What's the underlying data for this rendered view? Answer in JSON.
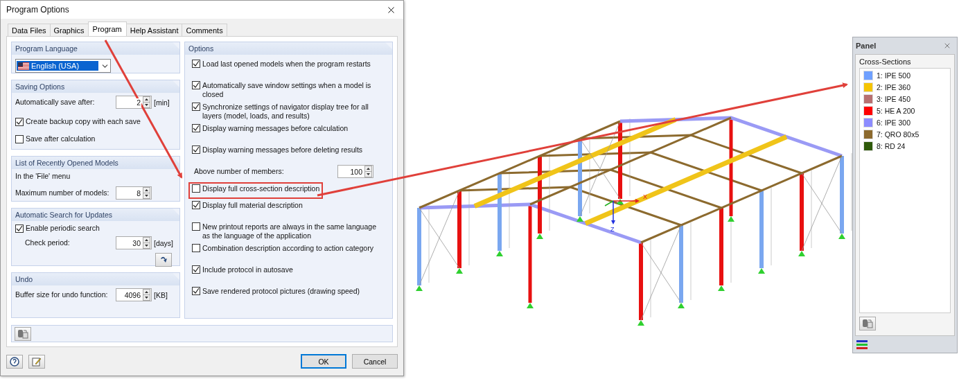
{
  "dialog": {
    "title": "Program Options",
    "tabs": [
      {
        "label": "Data Files",
        "selected": false
      },
      {
        "label": "Graphics",
        "selected": false
      },
      {
        "label": "Program",
        "selected": true
      },
      {
        "label": "Help Assistant",
        "selected": false
      },
      {
        "label": "Comments",
        "selected": false
      }
    ],
    "left_groups": [
      {
        "title": "Program Language",
        "rows": [
          {
            "kind": "dropdown",
            "value": "English (USA)"
          }
        ]
      },
      {
        "title": "Saving Options",
        "rows": [
          {
            "kind": "spinner",
            "label": "Automatically save after:",
            "value": "2",
            "unit": "[min]"
          },
          {
            "kind": "checkbox",
            "label": "Create backup copy with each save",
            "checked": true
          },
          {
            "kind": "checkbox",
            "label": "Save after calculation",
            "checked": false
          }
        ]
      },
      {
        "title": "List of Recently Opened Models",
        "rows": [
          {
            "kind": "text",
            "label": "In the 'File' menu"
          },
          {
            "kind": "spinner",
            "label": "Maximum number of models:",
            "value": "8"
          }
        ]
      },
      {
        "title": "Automatic Search for Updates",
        "rows": [
          {
            "kind": "checkbox",
            "label": "Enable periodic search",
            "checked": true
          },
          {
            "kind": "spinner",
            "label": "Check period:",
            "value": "30",
            "unit": "[days]",
            "indented": true
          },
          {
            "kind": "icon_button"
          }
        ]
      },
      {
        "title": "Undo",
        "rows": [
          {
            "kind": "spinner",
            "label": "Buffer size for undo function:",
            "value": "4096",
            "unit": "[KB]"
          }
        ]
      }
    ],
    "options": {
      "title": "Options",
      "items": [
        {
          "kind": "checkbox",
          "label": "Load last opened models when the program restarts",
          "checked": true
        },
        {
          "kind": "checkbox",
          "label": "Automatically save window settings when a model is closed",
          "checked": true
        },
        {
          "kind": "checkbox",
          "label": "Synchronize settings of navigator display tree for all layers (model, loads, and results)",
          "checked": true
        },
        {
          "kind": "checkbox",
          "label": "Display warning messages before calculation",
          "checked": true
        },
        {
          "kind": "checkbox",
          "label": "Display warning messages before deleting results",
          "checked": true
        },
        {
          "kind": "spinner",
          "label": "Above number of members:",
          "value": "100"
        },
        {
          "kind": "checkbox",
          "label": "Display full cross-section description",
          "checked": false,
          "highlighted": true
        },
        {
          "kind": "checkbox",
          "label": "Display full material description",
          "checked": true
        },
        {
          "kind": "checkbox",
          "label": "New printout reports are always in the same language as the language of the application",
          "checked": false
        },
        {
          "kind": "checkbox",
          "label": "Combination description according to action category",
          "checked": false
        },
        {
          "kind": "checkbox",
          "label": "Include protocol in autosave",
          "checked": true
        },
        {
          "kind": "checkbox",
          "label": "Save rendered protocol pictures (drawing speed)",
          "checked": true
        }
      ]
    },
    "buttons": [
      {
        "label": "OK",
        "default": true
      },
      {
        "label": "Cancel",
        "default": false
      }
    ]
  },
  "model": {
    "axes": [
      "X",
      "Z"
    ]
  },
  "panel": {
    "title": "Panel",
    "heading": "Cross-Sections",
    "items": [
      {
        "label": "1: IPE 500",
        "color": "#6fa0ff"
      },
      {
        "label": "2: IPE 360",
        "color": "#f5c400"
      },
      {
        "label": "3: IPE 450",
        "color": "#b87070"
      },
      {
        "label": "5: HE A 200",
        "color": "#ff0000"
      },
      {
        "label": "6: IPE 300",
        "color": "#8c8cff"
      },
      {
        "label": "7: QRO 80x5",
        "color": "#8c6a2e"
      },
      {
        "label": "8: RD 24",
        "color": "#2f5a0a"
      }
    ]
  }
}
